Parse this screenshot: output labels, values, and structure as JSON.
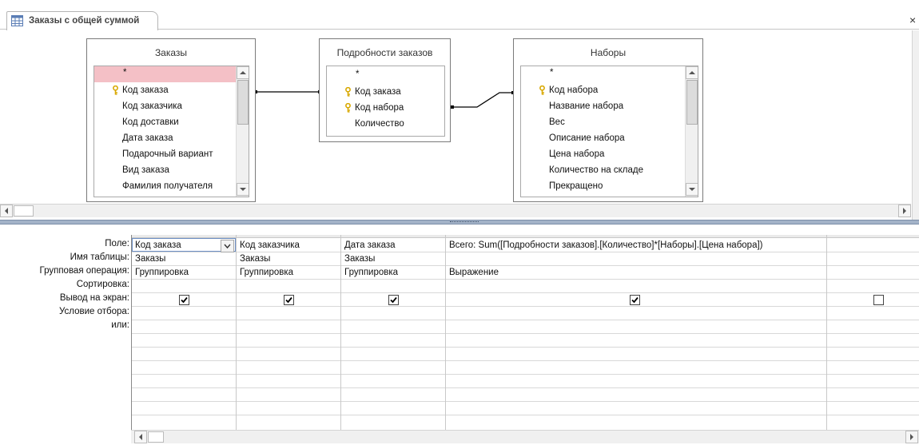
{
  "tab": {
    "title": "Заказы с общей суммой",
    "close_glyph": "×"
  },
  "tables": [
    {
      "title": "Заказы",
      "fields": [
        {
          "name": "*",
          "key": false,
          "selected": true
        },
        {
          "name": "Код заказа",
          "key": true
        },
        {
          "name": "Код заказчика",
          "key": false
        },
        {
          "name": "Код доставки",
          "key": false
        },
        {
          "name": "Дата заказа",
          "key": false
        },
        {
          "name": "Подарочный вариант",
          "key": false
        },
        {
          "name": "Вид заказа",
          "key": false
        },
        {
          "name": "Фамилия получателя",
          "key": false
        }
      ]
    },
    {
      "title": "Подробности заказов",
      "fields": [
        {
          "name": "*",
          "key": false
        },
        {
          "name": "Код заказа",
          "key": true
        },
        {
          "name": "Код набора",
          "key": true
        },
        {
          "name": "Количество",
          "key": false
        }
      ]
    },
    {
      "title": "Наборы",
      "fields": [
        {
          "name": "*",
          "key": false
        },
        {
          "name": "Код набора",
          "key": true
        },
        {
          "name": "Название набора",
          "key": false
        },
        {
          "name": "Вес",
          "key": false
        },
        {
          "name": "Описание набора",
          "key": false
        },
        {
          "name": "Цена набора",
          "key": false
        },
        {
          "name": "Количество на складе",
          "key": false
        },
        {
          "name": "Прекращено",
          "key": false
        }
      ]
    }
  ],
  "grid": {
    "row_labels": [
      "Поле:",
      "Имя таблицы:",
      "Групповая операция:",
      "Сортировка:",
      "Вывод на экран:",
      "Условие отбора:",
      "или:"
    ],
    "columns": [
      {
        "field": "Код заказа",
        "table": "Заказы",
        "group": "Группировка",
        "show": true
      },
      {
        "field": "Код заказчика",
        "table": "Заказы",
        "group": "Группировка",
        "show": true
      },
      {
        "field": "Дата заказа",
        "table": "Заказы",
        "group": "Группировка",
        "show": true
      },
      {
        "field": "Всего: Sum([Подробности заказов].[Количество]*[Наборы].[Цена набора])",
        "table": "",
        "group": "Выражение",
        "show": true
      },
      {
        "field": "",
        "table": "",
        "group": "",
        "show": false
      }
    ]
  },
  "colors": {
    "splitter": "#a3b3c8",
    "selected_field": "#f4c0c6",
    "key_icon": "#d8a800"
  }
}
